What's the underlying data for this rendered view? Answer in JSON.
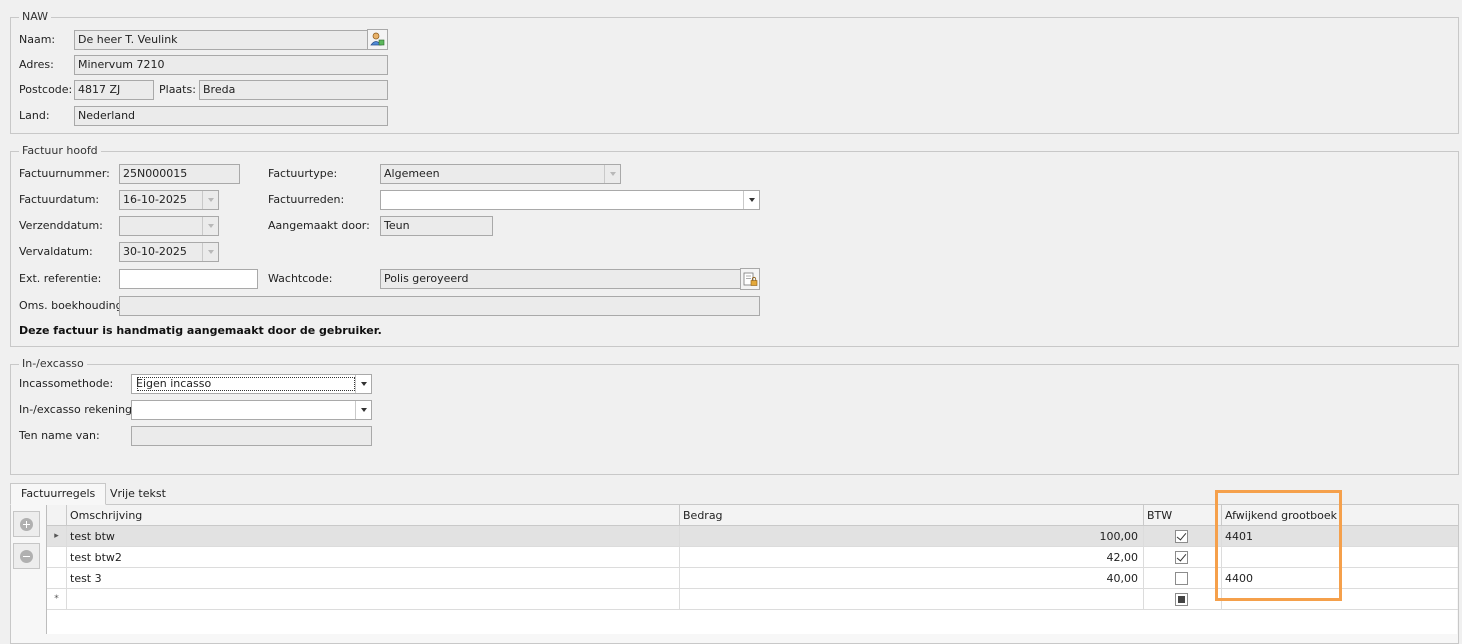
{
  "naw": {
    "legend": "NAW",
    "naam_label": "Naam:",
    "naam_value": "De heer T. Veulink",
    "adres_label": "Adres:",
    "adres_value": "Minervum 7210",
    "postcode_label": "Postcode:",
    "postcode_value": "4817 ZJ",
    "plaats_label": "Plaats:",
    "plaats_value": "Breda",
    "land_label": "Land:",
    "land_value": "Nederland"
  },
  "factuur": {
    "legend": "Factuur hoofd",
    "factuurnummer_label": "Factuurnummer:",
    "factuurnummer_value": "25N000015",
    "factuurtype_label": "Factuurtype:",
    "factuurtype_value": "Algemeen",
    "factuurdatum_label": "Factuurdatum:",
    "factuurdatum_value": "16-10-2025",
    "factuurreden_label": "Factuurreden:",
    "factuurreden_value": "",
    "verzenddatum_label": "Verzenddatum:",
    "verzenddatum_value": "",
    "aangemaakt_label": "Aangemaakt door:",
    "aangemaakt_value": "Teun",
    "vervaldatum_label": "Vervaldatum:",
    "vervaldatum_value": "30-10-2025",
    "ext_ref_label": "Ext. referentie:",
    "ext_ref_value": "",
    "wachtcode_label": "Wachtcode:",
    "wachtcode_value": "Polis geroyeerd",
    "oms_label": "Oms. boekhouding:",
    "oms_value": "",
    "note": "Deze factuur is handmatig aangemaakt door de gebruiker."
  },
  "incasso": {
    "legend": "In-/excasso",
    "methode_label": "Incassomethode:",
    "methode_value": "Eigen incasso",
    "rekening_label": "In-/excasso rekening:",
    "rekening_value": "",
    "tennamevan_label": "Ten name van:",
    "tennamevan_value": ""
  },
  "tabs": [
    {
      "label": "Factuurregels",
      "active": true
    },
    {
      "label": "Vrije tekst",
      "active": false
    }
  ],
  "grid": {
    "columns": [
      "Omschrijving",
      "Bedrag",
      "BTW",
      "Afwijkend grootboek"
    ],
    "rows": [
      {
        "omschrijving": "test btw",
        "bedrag": "100,00",
        "btw": true,
        "grootboek": "4401"
      },
      {
        "omschrijving": "test btw2",
        "bedrag": "42,00",
        "btw": true,
        "grootboek": ""
      },
      {
        "omschrijving": "test 3",
        "bedrag": "40,00",
        "btw": false,
        "grootboek": "4400"
      }
    ],
    "new_row_marker": "*",
    "current_row_marker": "▸"
  },
  "colors": {
    "highlight": "#f5a04b",
    "background": "#f0f0f0",
    "selected_row": "#e2e2e2"
  }
}
